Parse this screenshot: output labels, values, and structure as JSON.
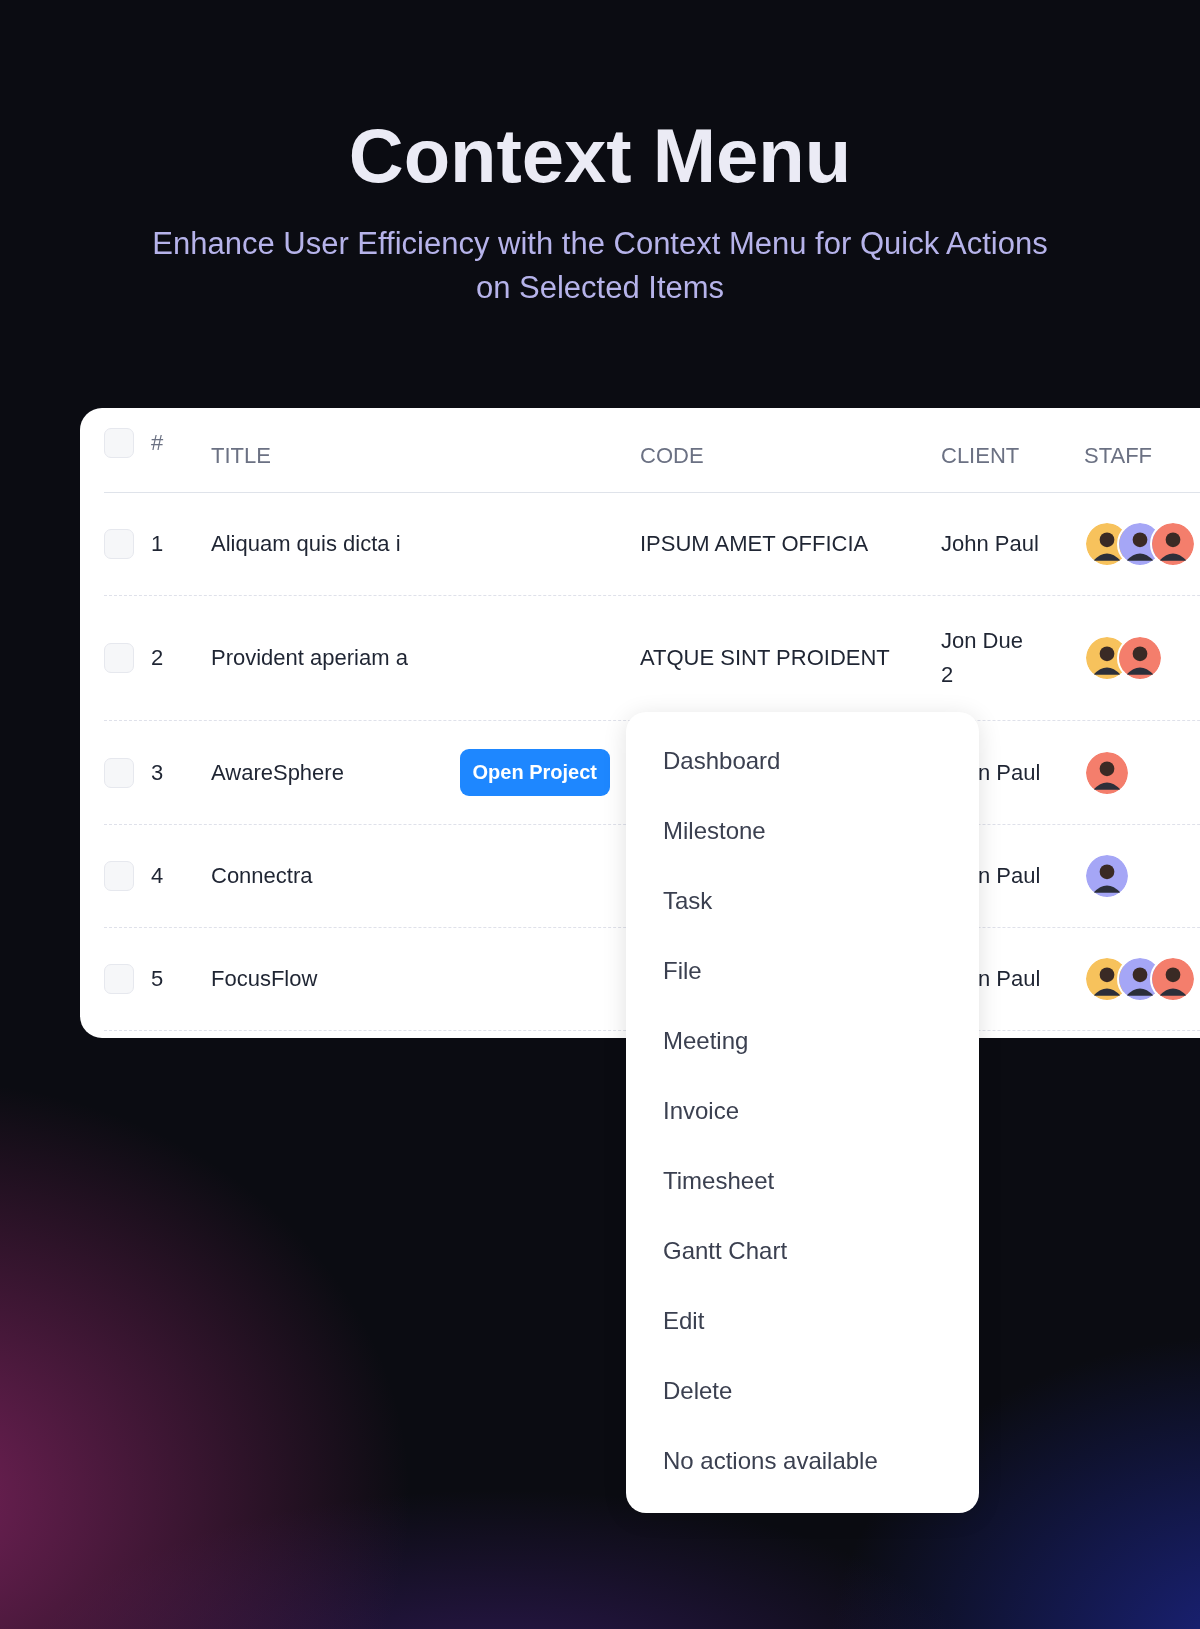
{
  "hero": {
    "title": "Context Menu",
    "subtitle": "Enhance User Efficiency with the Context Menu for Quick Actions on Selected Items"
  },
  "table": {
    "header_checked": false,
    "columns": [
      "#",
      "TITLE",
      "CODE",
      "CLIENT",
      "STAFF"
    ],
    "rows": [
      {
        "checked": false,
        "number": "1",
        "title": "Aliquam quis dicta i",
        "code": "IPSUM AMET OFFICIA",
        "client": "John Paul",
        "client_covered": false,
        "staff": [
          {
            "color": "#f7c25c"
          },
          {
            "color": "#a5a6f6"
          },
          {
            "color": "#f47e6c"
          }
        ]
      },
      {
        "checked": false,
        "number": "2",
        "title": "Provident aperiam a",
        "code": "ATQUE SINT PROIDENT",
        "client": "Jon Due 2",
        "client_covered": false,
        "staff": [
          {
            "color": "#f7c25c"
          },
          {
            "color": "#f47e6c"
          }
        ]
      },
      {
        "checked": false,
        "number": "3",
        "title": "AwareSphere",
        "button": "Open Project",
        "client": "n Paul",
        "client_covered": true,
        "staff": [
          {
            "color": "#f47e6c"
          }
        ]
      },
      {
        "checked": false,
        "number": "4",
        "title": "Connectra",
        "client": "n Paul",
        "client_covered": true,
        "staff": [
          {
            "color": "#a5a6f6"
          }
        ]
      },
      {
        "checked": false,
        "number": "5",
        "title": "FocusFlow",
        "client": "n Paul",
        "client_covered": true,
        "staff": [
          {
            "color": "#f7c25c"
          },
          {
            "color": "#a5a6f6"
          },
          {
            "color": "#f47e6c"
          }
        ]
      }
    ]
  },
  "context_menu": {
    "items": [
      "Dashboard",
      "Milestone",
      "Task",
      "File",
      "Meeting",
      "Invoice",
      "Timesheet",
      "Gantt Chart",
      "Edit",
      "Delete",
      "No actions available"
    ]
  }
}
